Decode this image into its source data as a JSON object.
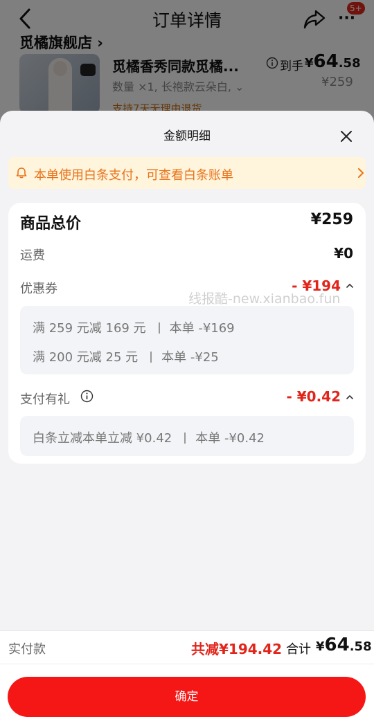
{
  "nav": {
    "title": "订单详情",
    "badge": "5+",
    "more_glyph": "···"
  },
  "order": {
    "shop_name": "觅橘旗舰店 ›",
    "product_title": "觅橘香秀同款觅橘...",
    "product_spec": "数量 ×1, 长袍款云朵白, ⌄",
    "return_policy": "支持7天无理由退货",
    "price_label": "到手",
    "price_currency": "¥",
    "price_int": "64",
    "price_dec": ".58",
    "original_price": "¥259"
  },
  "sheet": {
    "title": "金额明细",
    "notice": "本单使用白条支付，可查看白条账单",
    "total_label": "商品总价",
    "total_value": "¥259",
    "shipping_label": "运费",
    "shipping_value": "¥0",
    "coupon_label": "优惠券",
    "coupon_value": "- ¥194",
    "coupon_lines": [
      {
        "desc": "满 259 元减 169 元",
        "amount": "本单 -¥169"
      },
      {
        "desc": "满 200 元减 25 元",
        "amount": "本单 -¥25"
      }
    ],
    "gift_label": "支付有礼",
    "gift_value": "- ¥0.42",
    "gift_lines": [
      {
        "desc": "白条立减本单立减 ¥0.42",
        "amount": "本单 -¥0.42"
      }
    ],
    "watermark": "线报酷-new.xianbao.fun"
  },
  "bottom": {
    "paid_label": "实付款",
    "saved": "共减¥194.42",
    "sum_label": "合计",
    "sum_currency": "¥",
    "sum_int": "64",
    "sum_dec": ".58",
    "confirm_label": "确定"
  },
  "icons": {
    "back": "chevron-left-icon",
    "share": "share-icon",
    "more": "more-icon",
    "close": "close-icon",
    "bell": "bell-icon",
    "chevron_right": "chevron-right-icon",
    "caret_up": "caret-up-icon",
    "info": "info-icon"
  },
  "colors": {
    "accent_red": "#e1251b",
    "button_red": "#f51616",
    "notice_bg": "#fff4dc",
    "notice_text": "#e8731a"
  }
}
